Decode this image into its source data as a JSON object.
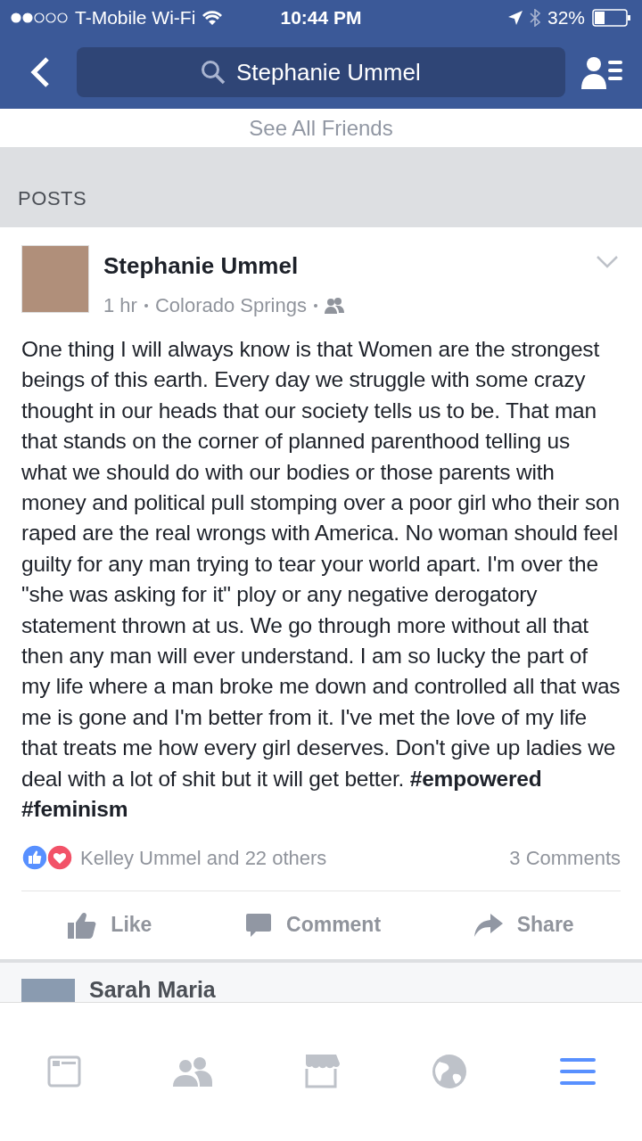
{
  "status_bar": {
    "carrier": "T-Mobile Wi-Fi",
    "time": "10:44 PM",
    "battery": "32%"
  },
  "nav_bar": {
    "search_value": "Stephanie Ummel"
  },
  "see_all_friends": "See All Friends",
  "section_title": "POSTS",
  "post": {
    "author": "Stephanie Ummel",
    "time": "1 hr",
    "location": "Colorado Springs",
    "text": "One thing I will always know is that Women are the strongest beings of this earth. Every day we struggle with some crazy thought in our heads that our society tells us to be. That man that stands on the corner of planned parenthood telling us what we should do with our bodies or those parents with money and political pull stomping over a poor girl who their son raped are the real wrongs with America. No woman should feel guilty for any man trying to tear your world apart. I'm over the \"she was asking for it\" ploy or any negative derogatory statement thrown at us. We go through more without all that then any man will ever understand. I am so lucky the part of my life where a man broke me down and controlled all that was me is gone and I'm better from it. I've met the love of my life that treats me how every girl deserves. Don't give up ladies we deal with a lot of shit but it will get better. **#empowered #feminism**",
    "reactions": "Kelley Ummel and 22 others",
    "comments": "3 Comments",
    "actions": [
      {
        "kind": "like",
        "label": "Like"
      },
      {
        "kind": "comment",
        "label": "Comment"
      },
      {
        "kind": "share",
        "label": "Share"
      }
    ]
  },
  "next_post": {
    "author": "Sarah Maria"
  },
  "tab_bar": [
    {
      "kind": "feed",
      "selected": false
    },
    {
      "kind": "friends",
      "selected": false
    },
    {
      "kind": "marketplace",
      "selected": false
    },
    {
      "kind": "notifications",
      "selected": false
    },
    {
      "kind": "menu",
      "selected": true
    }
  ]
}
